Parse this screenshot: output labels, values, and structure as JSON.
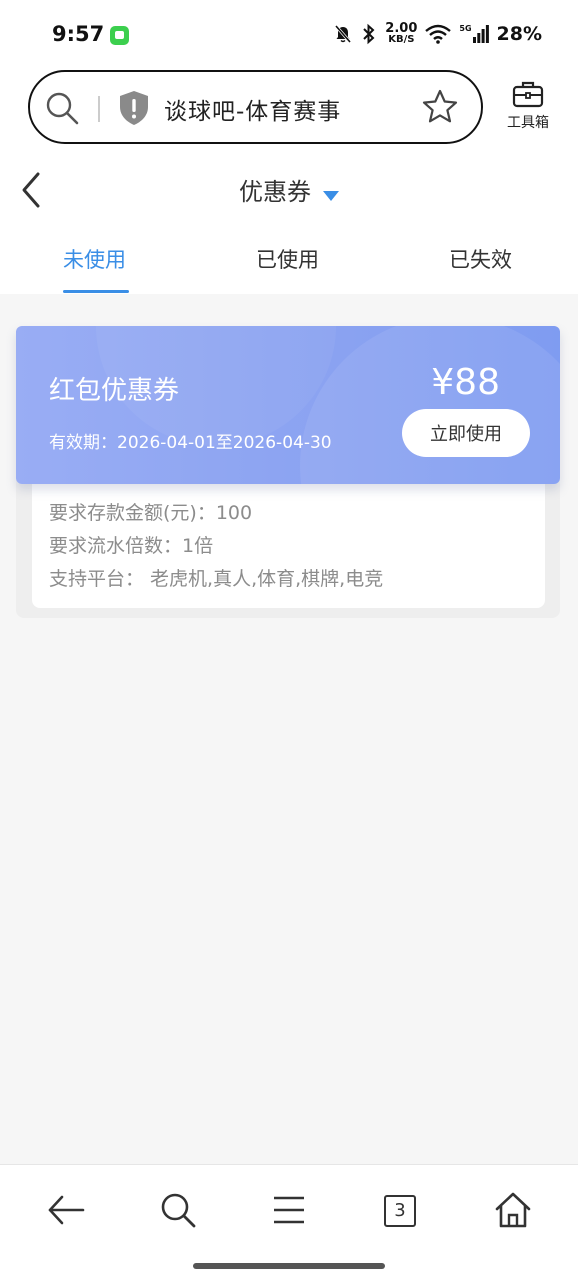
{
  "status_bar": {
    "time": "9:57",
    "net_speed_value": "2.00",
    "net_speed_unit": "KB/S",
    "network_type": "5G",
    "battery": "28%"
  },
  "browser": {
    "url_title": "谈球吧-体育赛事",
    "toolbox_label": "工具箱",
    "open_tabs_count": "3"
  },
  "header": {
    "title": "优惠券"
  },
  "tabs": [
    {
      "label": "未使用",
      "active": true
    },
    {
      "label": "已使用",
      "active": false
    },
    {
      "label": "已失效",
      "active": false
    }
  ],
  "coupon": {
    "name": "红包优惠券",
    "amount": "¥88",
    "validity": "有效期：2026-04-01至2026-04-30",
    "button_label": "立即使用",
    "details": [
      "要求存款金额(元)：100",
      "要求流水倍数：1倍",
      "支持平台：  老虎机,真人,体育,棋牌,电竞"
    ]
  },
  "colors": {
    "accent": "#3a8ee6",
    "coupon_gradient_start": "#99adf4",
    "coupon_gradient_end": "#7f9cf1"
  }
}
